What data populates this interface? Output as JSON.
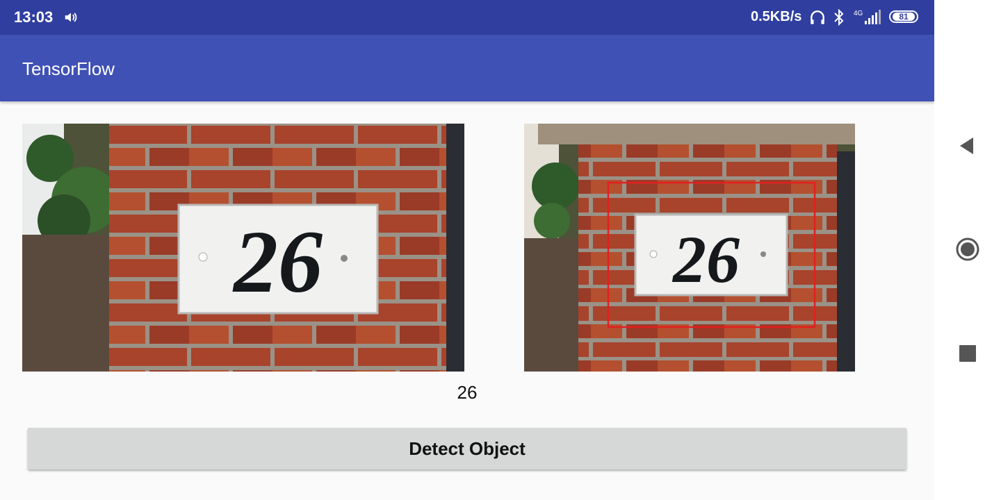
{
  "status_bar": {
    "time": "13:03",
    "net_speed": "0.5KB/s",
    "network_type": "4G",
    "battery": "81"
  },
  "app_bar": {
    "title": "TensorFlow"
  },
  "main": {
    "input_image": {
      "plaque_text": "26"
    },
    "output_image": {
      "plaque_text": "26",
      "box_color": "#e02020"
    },
    "result_text": "26",
    "detect_button_label": "Detect Object"
  },
  "colors": {
    "status_bar": "#303f9f",
    "app_bar": "#3f51b5",
    "button": "#d6d7d7"
  }
}
